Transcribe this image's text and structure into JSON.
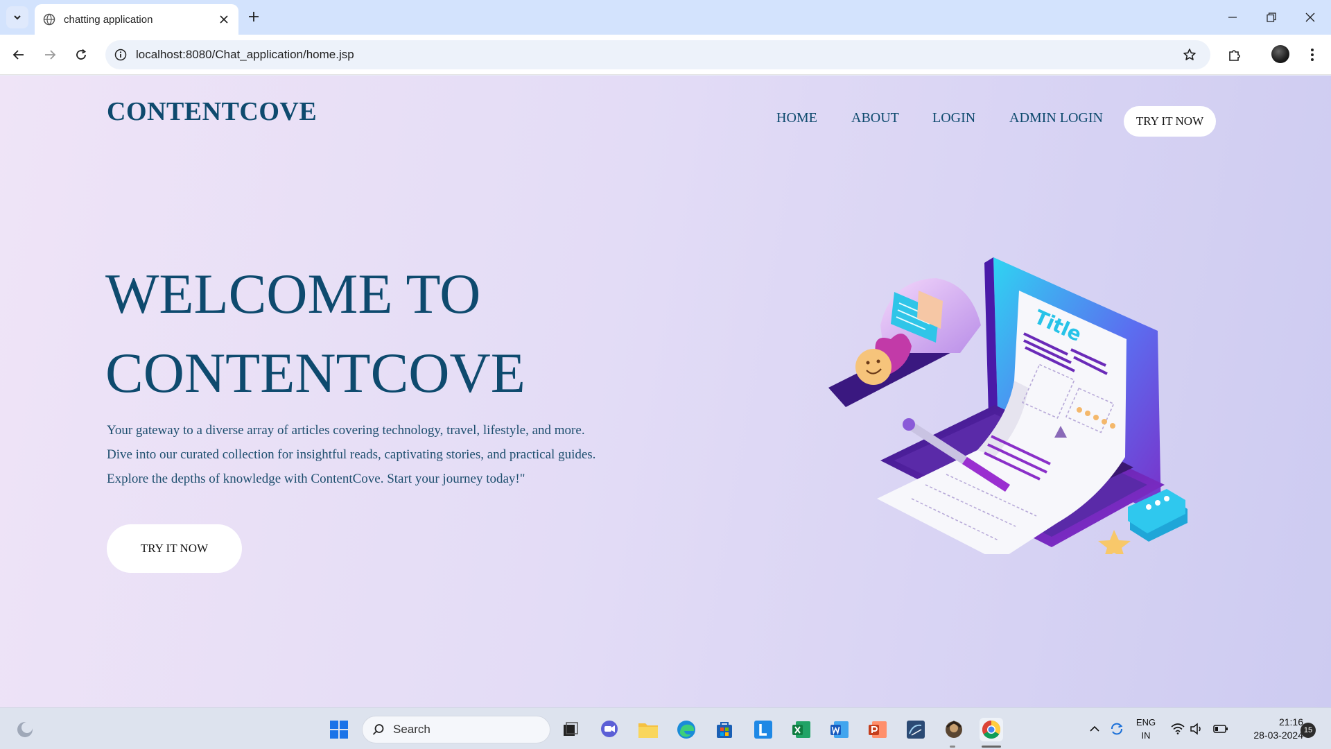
{
  "browser": {
    "tab_title": "chatting application",
    "url": "localhost:8080/Chat_application/home.jsp"
  },
  "site": {
    "brand": "CONTENTCOVE",
    "nav": [
      "HOME",
      "ABOUT",
      "LOGIN",
      "ADMIN LOGIN"
    ],
    "nav_cta": "TRY IT NOW",
    "hero_line1": "WELCOME TO",
    "hero_line2": "CONTENTCOVE",
    "description_lines": [
      "Your gateway to a diverse array of articles covering technology, travel, lifestyle, and more.",
      "Dive into our curated collection for insightful reads, captivating stories, and practical guides.",
      "Explore the depths of knowledge with ContentCove. Start your journey today!\""
    ],
    "hero_cta": "TRY IT NOW",
    "illustration_text": "Title",
    "colors": {
      "brand_text": "#0e4a6e",
      "button_bg": "#ffffff"
    }
  },
  "taskbar": {
    "search_placeholder": "Search",
    "lang_top": "ENG",
    "lang_bottom": "IN",
    "time": "21:16",
    "date": "28-03-2024",
    "notifications": "15"
  }
}
